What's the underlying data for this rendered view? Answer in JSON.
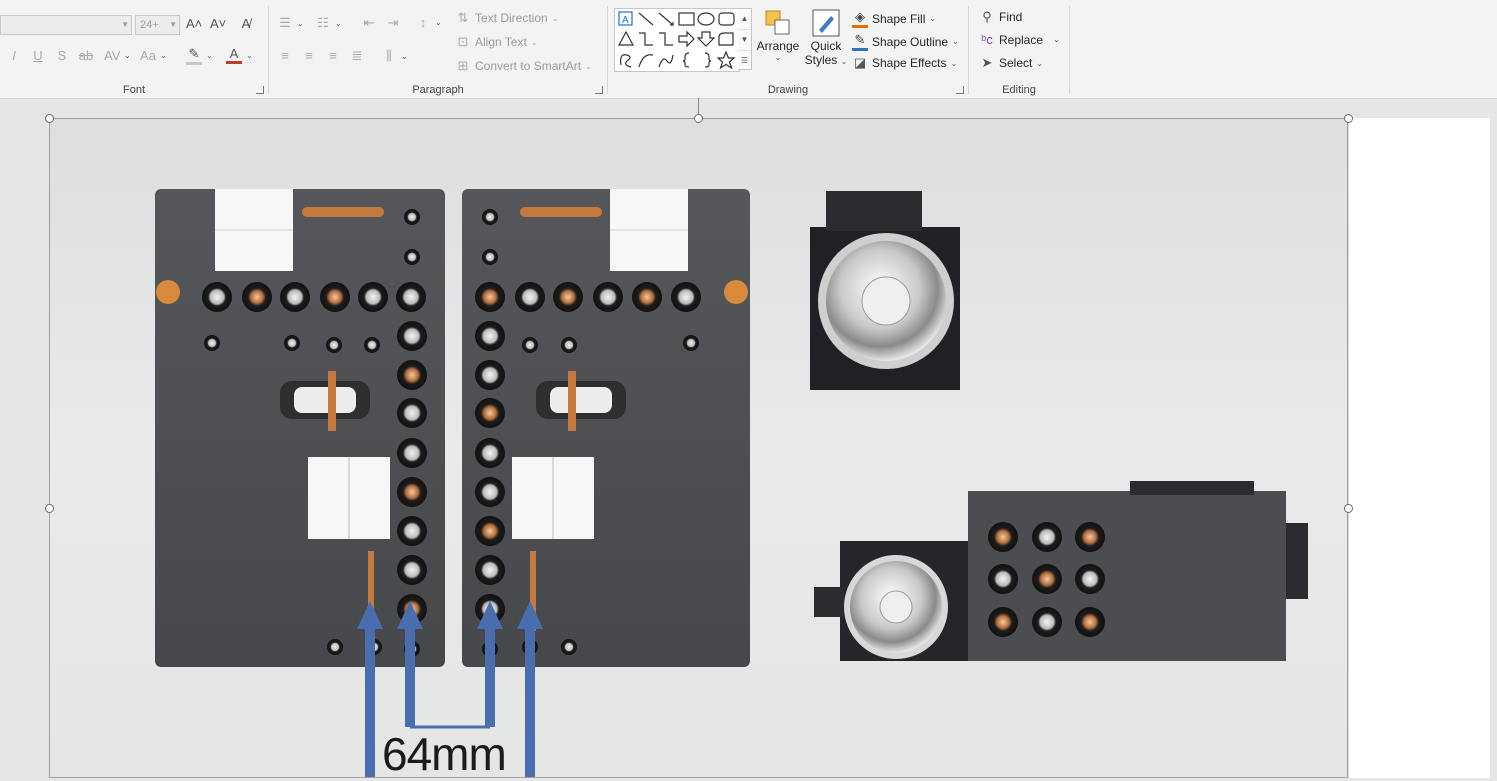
{
  "ribbon": {
    "font": {
      "label": "Font",
      "font_size": "24+"
    },
    "paragraph": {
      "label": "Paragraph",
      "text_direction": "Text Direction",
      "align_text": "Align Text",
      "convert_smartart": "Convert to SmartArt"
    },
    "drawing": {
      "label": "Drawing",
      "arrange": "Arrange",
      "quick_styles_line1": "Quick",
      "quick_styles_line2": "Styles",
      "shape_fill": "Shape Fill",
      "shape_outline": "Shape Outline",
      "shape_effects": "Shape Effects"
    },
    "editing": {
      "label": "Editing",
      "find": "Find",
      "replace": "Replace",
      "select": "Select"
    }
  },
  "slide": {
    "image_caption": "64mm"
  },
  "colors": {
    "arrow_blue": "#4a6db0",
    "module_dark": "#4a4c50"
  }
}
